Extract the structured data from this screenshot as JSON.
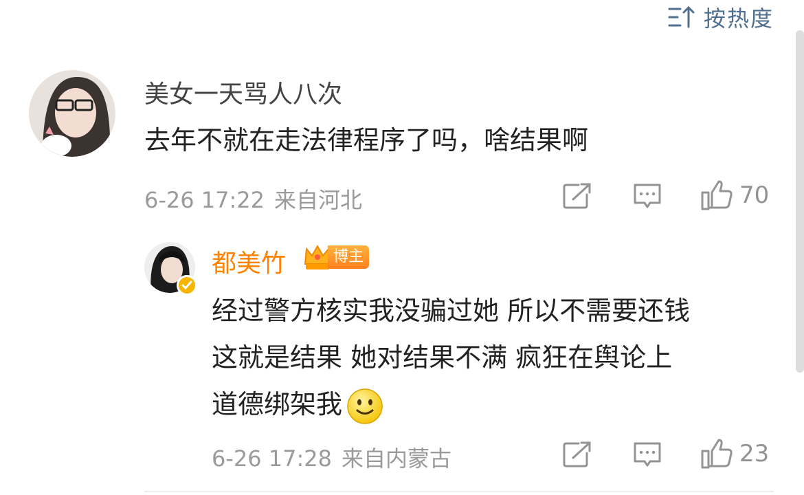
{
  "sort": {
    "label": "按热度",
    "icon": "sort-icon"
  },
  "comment": {
    "username": "美女一天骂人八次",
    "text": "去年不就在走法律程序了吗，啥结果啊",
    "time": "6-26 17:22",
    "location": "来自河北",
    "likes": "70",
    "icons": [
      "repost-icon",
      "comment-icon",
      "like-icon"
    ]
  },
  "reply": {
    "username": "都美竹",
    "badge": "博主",
    "lines": [
      "经过警方核实我没骗过她 所以不需要还钱",
      "这就是结果 她对结果不满 疯狂在舆论上",
      "道德绑架我"
    ],
    "emoji": "smile-emoji",
    "time": "6-26 17:28",
    "location": "来自内蒙古",
    "likes": "23",
    "icons": [
      "repost-icon",
      "comment-icon",
      "like-icon"
    ]
  },
  "colors": {
    "accent_orange": "#ff8200",
    "meta_gray": "#9a9a9a",
    "sort_blue": "#4f6f8f"
  }
}
